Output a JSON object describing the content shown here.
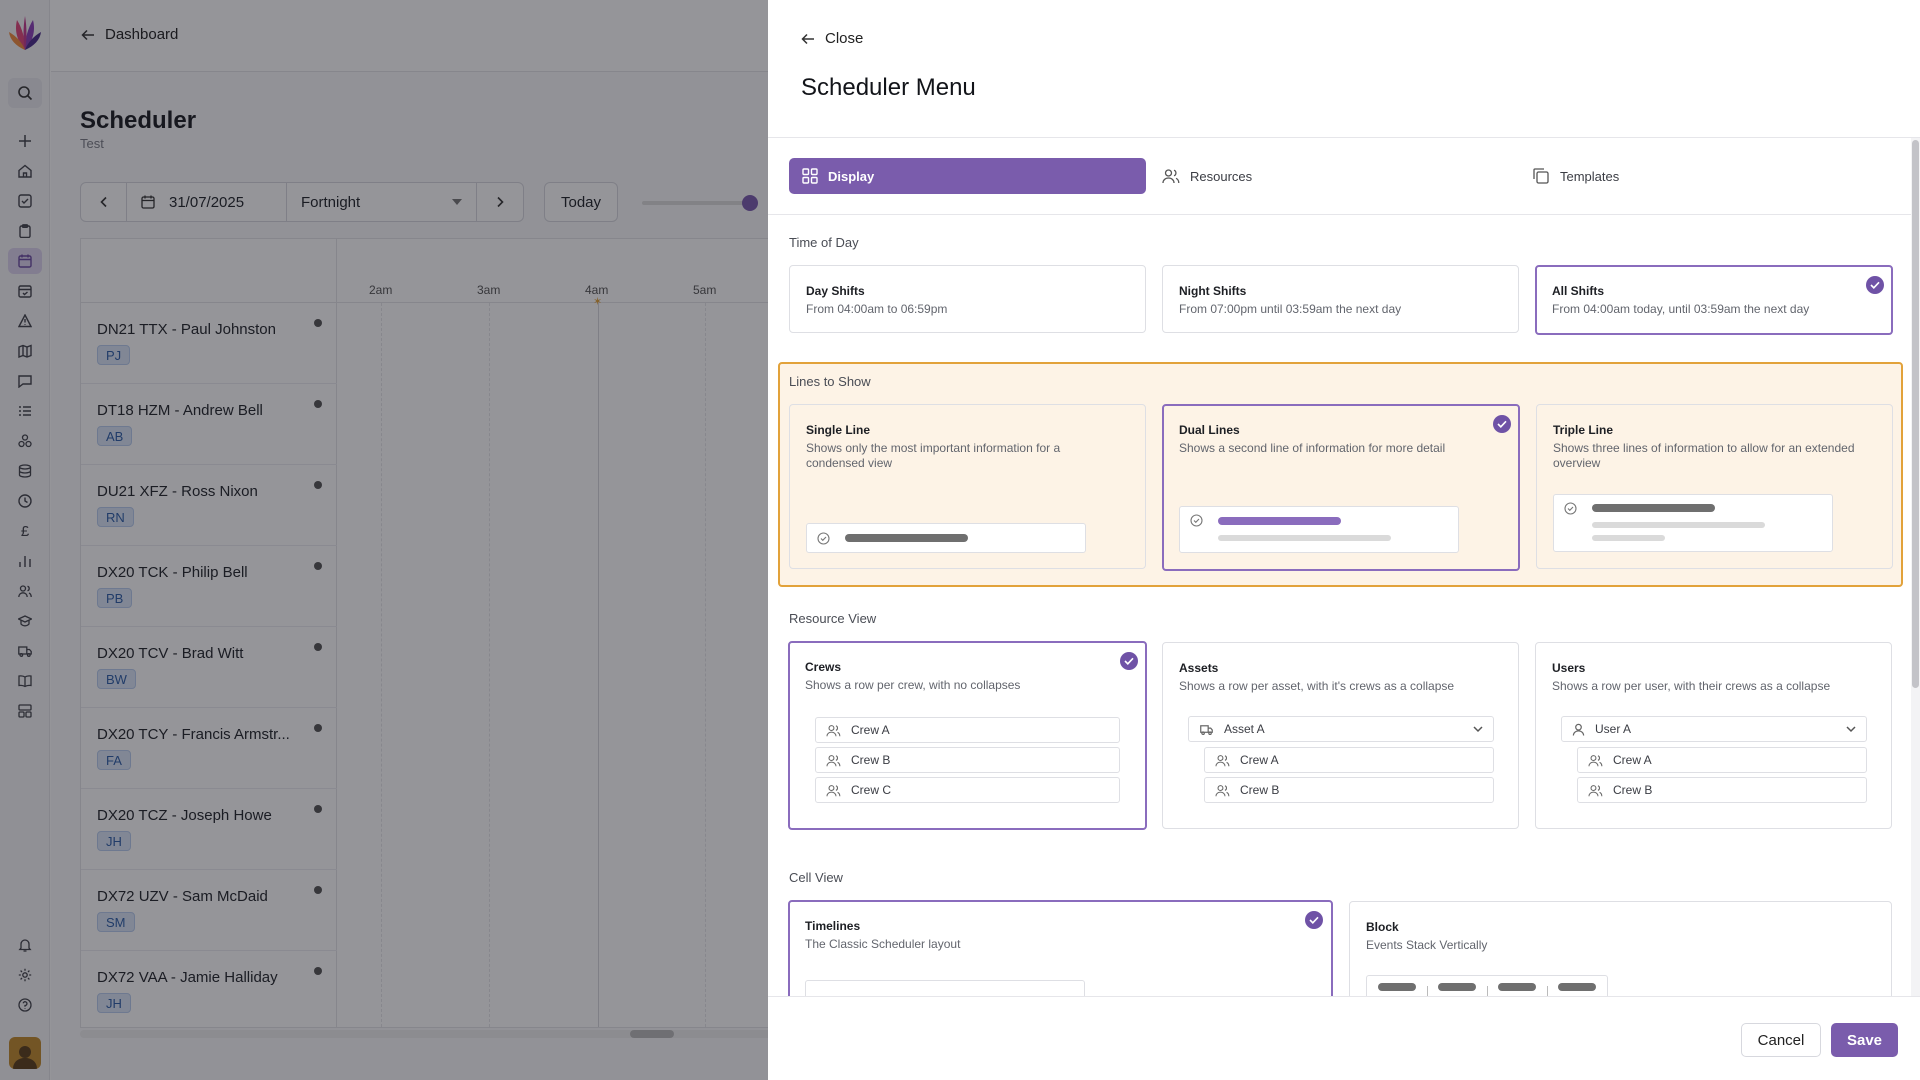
{
  "nav": {
    "back_label": "Dashboard"
  },
  "scheduler": {
    "title": "Scheduler",
    "subtitle": "Test",
    "date": "31/07/2025",
    "range": "Fortnight",
    "today_label": "Today",
    "hours": [
      "2am",
      "3am",
      "4am",
      "5am"
    ],
    "rows": [
      {
        "name": "DN21 TTX - Paul Johnston",
        "initials": "PJ"
      },
      {
        "name": "DT18 HZM - Andrew Bell",
        "initials": "AB"
      },
      {
        "name": "DU21 XFZ - Ross Nixon",
        "initials": "RN"
      },
      {
        "name": "DX20 TCK - Philip Bell",
        "initials": "PB"
      },
      {
        "name": "DX20 TCV - Brad Witt",
        "initials": "BW"
      },
      {
        "name": "DX20 TCY - Francis Armstr...",
        "initials": "FA"
      },
      {
        "name": "DX20 TCZ - Joseph Howe",
        "initials": "JH"
      },
      {
        "name": "DX72 UZV - Sam McDaid",
        "initials": "SM"
      },
      {
        "name": "DX72 VAA - Jamie Halliday",
        "initials": "JH"
      }
    ]
  },
  "drawer": {
    "close_label": "Close",
    "title": "Scheduler Menu",
    "tabs": [
      {
        "label": "Display",
        "icon": "grid-icon",
        "active": true
      },
      {
        "label": "Resources",
        "icon": "users-icon",
        "active": false
      },
      {
        "label": "Templates",
        "icon": "copy-icon",
        "active": false
      }
    ],
    "time_of_day": {
      "label": "Time of Day",
      "options": [
        {
          "title": "Day Shifts",
          "desc": "From 04:00am to 06:59pm",
          "selected": false
        },
        {
          "title": "Night Shifts",
          "desc": "From 07:00pm until 03:59am the next day",
          "selected": false
        },
        {
          "title": "All Shifts",
          "desc": "From 04:00am today, until 03:59am the next day",
          "selected": true
        }
      ]
    },
    "lines": {
      "label": "Lines to Show",
      "options": [
        {
          "title": "Single Line",
          "desc": "Shows only the most important information for a condensed view",
          "selected": false
        },
        {
          "title": "Dual Lines",
          "desc": "Shows a second line of information for more detail",
          "selected": true
        },
        {
          "title": "Triple Line",
          "desc": "Shows three lines of information to allow for an extended overview",
          "selected": false
        }
      ]
    },
    "resource_view": {
      "label": "Resource View",
      "options": [
        {
          "title": "Crews",
          "desc": "Shows a row per crew, with no collapses",
          "selected": true,
          "items": [
            "Crew A",
            "Crew B",
            "Crew C"
          ]
        },
        {
          "title": "Assets",
          "desc": "Shows a row per asset, with it's crews as a collapse",
          "selected": false,
          "parent": "Asset A",
          "items": [
            "Crew A",
            "Crew B"
          ]
        },
        {
          "title": "Users",
          "desc": "Shows a row per user, with their crews as a collapse",
          "selected": false,
          "parent": "User A",
          "items": [
            "Crew A",
            "Crew B"
          ]
        }
      ]
    },
    "cell_view": {
      "label": "Cell View",
      "options": [
        {
          "title": "Timelines",
          "desc": "The Classic Scheduler layout",
          "selected": true
        },
        {
          "title": "Block",
          "desc": "Events Stack Vertically",
          "selected": false
        }
      ]
    },
    "cancel_label": "Cancel",
    "save_label": "Save"
  },
  "colors": {
    "accent": "#7a5cac",
    "highlight_border": "#e2a23a",
    "highlight_bg": "#fdf3e6",
    "badge_bg": "#dbe6f7"
  }
}
